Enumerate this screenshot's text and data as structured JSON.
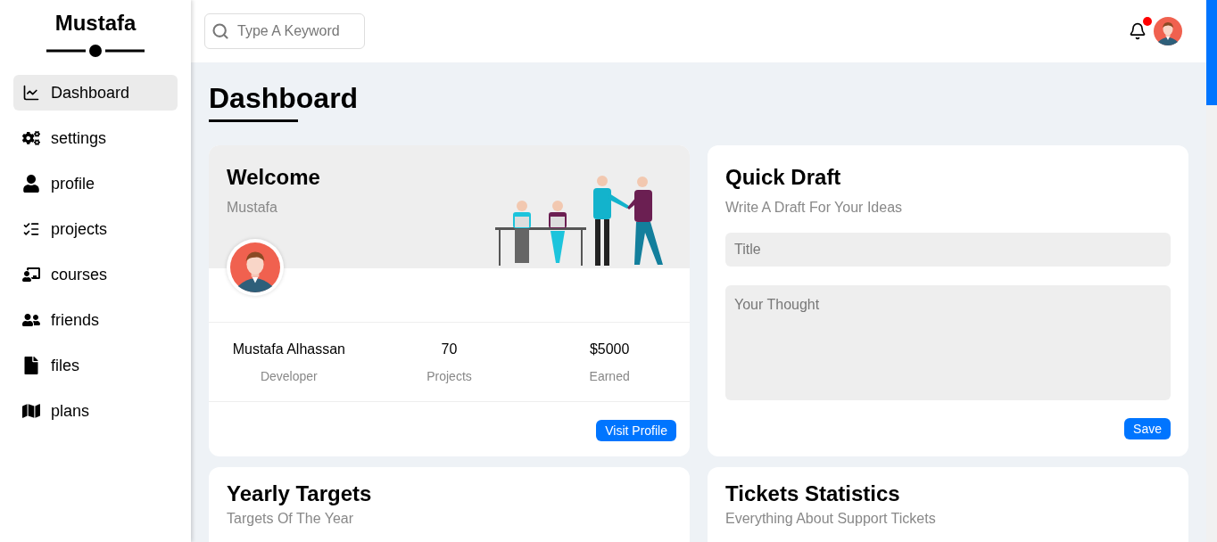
{
  "sidebar": {
    "title": "Mustafa",
    "items": [
      {
        "label": "Dashboard",
        "selected": true
      },
      {
        "label": "settings",
        "selected": false
      },
      {
        "label": "profile",
        "selected": false
      },
      {
        "label": "projects",
        "selected": false
      },
      {
        "label": "courses",
        "selected": false
      },
      {
        "label": "friends",
        "selected": false
      },
      {
        "label": "files",
        "selected": false
      },
      {
        "label": "plans",
        "selected": false
      }
    ]
  },
  "header": {
    "search": {
      "placeholder": "Type A Keyword"
    },
    "notifications": {
      "unread": true
    }
  },
  "page_title": "Dashboard",
  "welcome": {
    "title": "Welcome",
    "subtitle": "Mustafa",
    "stats": [
      {
        "value": "Mustafa Alhassan",
        "label": "Developer"
      },
      {
        "value": "70",
        "label": "Projects"
      },
      {
        "value": "$5000",
        "label": "Earned"
      }
    ],
    "button": "Visit Profile"
  },
  "quick_draft": {
    "title": "Quick Draft",
    "subtitle": "Write A Draft For Your Ideas",
    "title_field": {
      "placeholder": "Title"
    },
    "body_field": {
      "placeholder": "Your Thought"
    },
    "button": "Save"
  },
  "cards": [
    {
      "title": "Yearly Targets",
      "subtitle": "Targets Of The Year"
    },
    {
      "title": "Tickets Statistics",
      "subtitle": "Everything About Support Tickets"
    }
  ]
}
